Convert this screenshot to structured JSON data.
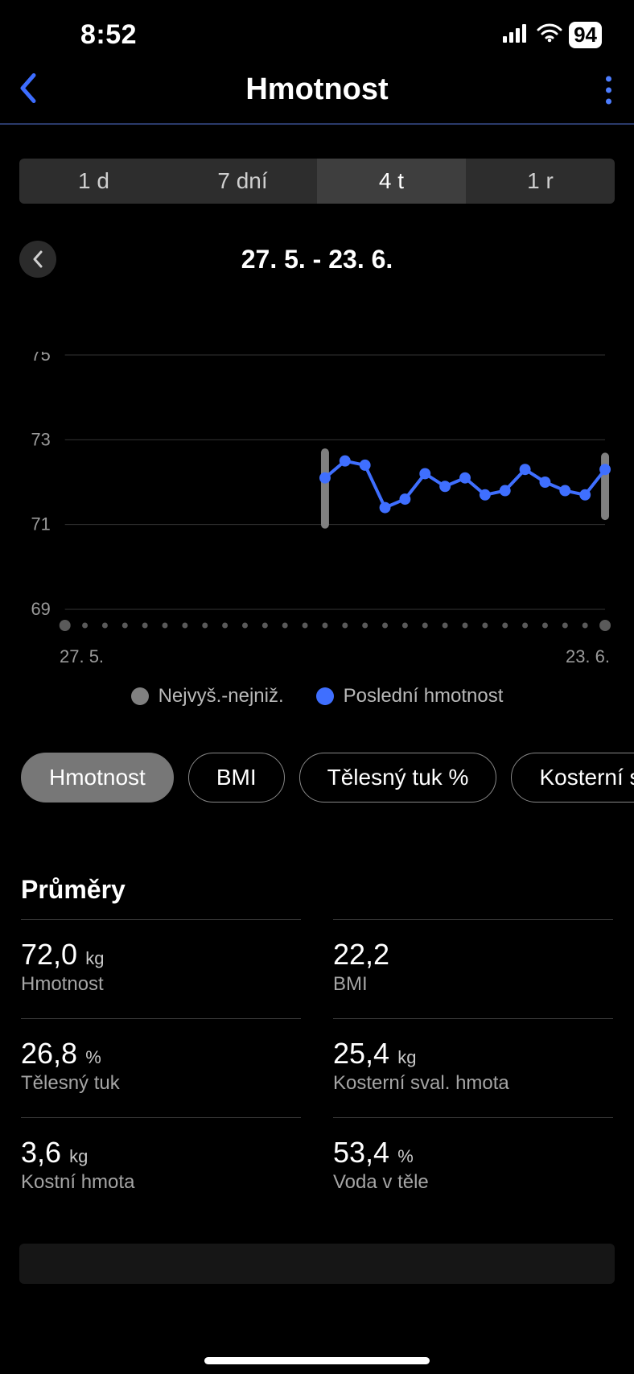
{
  "status": {
    "time": "8:52",
    "battery": "94"
  },
  "header": {
    "title": "Hmotnost"
  },
  "period": {
    "items": [
      "1 d",
      "7 dní",
      "4 t",
      "1 r"
    ],
    "active_index": 2
  },
  "date_range": "27. 5. - 23. 6.",
  "chart_data": {
    "type": "line",
    "title": "",
    "xlabel": "",
    "ylabel": "",
    "y_ticks": [
      69,
      71,
      73,
      75
    ],
    "ylim": [
      69,
      75
    ],
    "x_start_label": "27. 5.",
    "x_end_label": "23. 6.",
    "n_days": 28,
    "range_bars": [
      {
        "day_index": 13,
        "low": 71.0,
        "high": 72.7
      },
      {
        "day_index": 27,
        "low": 71.2,
        "high": 72.6
      }
    ],
    "series": [
      {
        "name": "Poslední hmotnost",
        "color": "#3f6fff",
        "points": [
          {
            "day_index": 13,
            "value": 72.1
          },
          {
            "day_index": 14,
            "value": 72.5
          },
          {
            "day_index": 15,
            "value": 72.4
          },
          {
            "day_index": 16,
            "value": 71.4
          },
          {
            "day_index": 17,
            "value": 71.6
          },
          {
            "day_index": 18,
            "value": 72.2
          },
          {
            "day_index": 19,
            "value": 71.9
          },
          {
            "day_index": 20,
            "value": 72.1
          },
          {
            "day_index": 21,
            "value": 71.7
          },
          {
            "day_index": 22,
            "value": 71.8
          },
          {
            "day_index": 23,
            "value": 72.3
          },
          {
            "day_index": 24,
            "value": 72.0
          },
          {
            "day_index": 25,
            "value": 71.8
          },
          {
            "day_index": 26,
            "value": 71.7
          },
          {
            "day_index": 27,
            "value": 72.3
          }
        ]
      }
    ],
    "legend": [
      {
        "label": "Nejvyš.-nejniž.",
        "color": "#808080"
      },
      {
        "label": "Poslední hmotnost",
        "color": "#3f6fff"
      }
    ]
  },
  "pills": {
    "items": [
      "Hmotnost",
      "BMI",
      "Tělesný tuk %",
      "Kosterní sval"
    ],
    "active_index": 0
  },
  "averages": {
    "title": "Průměry",
    "cells": [
      {
        "value": "72,0",
        "unit": "kg",
        "label": "Hmotnost"
      },
      {
        "value": "22,2",
        "unit": "",
        "label": "BMI"
      },
      {
        "value": "26,8",
        "unit": "%",
        "label": "Tělesný tuk"
      },
      {
        "value": "25,4",
        "unit": "kg",
        "label": "Kosterní sval. hmota"
      },
      {
        "value": "3,6",
        "unit": "kg",
        "label": "Kostní hmota"
      },
      {
        "value": "53,4",
        "unit": "%",
        "label": "Voda v těle"
      }
    ]
  }
}
